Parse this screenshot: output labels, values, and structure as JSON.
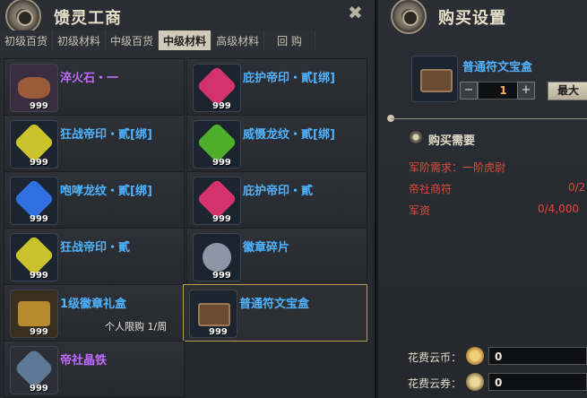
{
  "left_panel": {
    "title": "馈灵工商",
    "tabs": [
      {
        "label": "初级百货",
        "active": false
      },
      {
        "label": "初级材料",
        "active": false
      },
      {
        "label": "中级百货",
        "active": false
      },
      {
        "label": "中级材料",
        "active": true
      },
      {
        "label": "高级材料",
        "active": false
      },
      {
        "label": "回 购",
        "active": false
      }
    ],
    "items": [
      {
        "name": "淬火石・一",
        "count": "999",
        "icon": "ore-icon",
        "color": "#c06cff"
      },
      {
        "name": "庇护帝印・貳[绑]",
        "count": "999",
        "icon": "pink-gem-icon",
        "color": "#4fb4ff"
      },
      {
        "name": "狂战帝印・貳[绑]",
        "count": "999",
        "icon": "yellow-gem-icon",
        "color": "#4fb4ff"
      },
      {
        "name": "威慑龙纹・貳[绑]",
        "count": "999",
        "icon": "green-gem-icon",
        "color": "#4fb4ff"
      },
      {
        "name": "咆哮龙纹・貳[绑]",
        "count": "999",
        "icon": "blue-gem-icon",
        "color": "#4fb4ff"
      },
      {
        "name": "庇护帝印・貳",
        "count": "999",
        "icon": "pink-gem-icon",
        "color": "#4fb4ff"
      },
      {
        "name": "狂战帝印・貳",
        "count": "999",
        "icon": "yellow-gem-icon",
        "color": "#4fb4ff"
      },
      {
        "name": "徽章碎片",
        "count": "999",
        "icon": "badge-shard-icon",
        "color": "#4fb4ff"
      },
      {
        "name": "1级徽章礼盒",
        "count": "999",
        "icon": "gold-chest-icon",
        "color": "#4fb4ff",
        "limit": "个人限购 1/周"
      },
      {
        "name": "普通符文宝盒",
        "count": "999",
        "icon": "rune-chest-icon",
        "color": "#4fb4ff",
        "selected": true
      },
      {
        "name": "帝社晶铁",
        "count": "999",
        "icon": "crystal-iron-icon",
        "color": "#c06cff"
      }
    ]
  },
  "right_panel": {
    "title": "购买设置",
    "selected_item": "普通符文宝盒",
    "quantity": "1",
    "minus_label": "−",
    "plus_label": "+",
    "max_label": "最大",
    "requirements_title": "购买需要",
    "requirements": [
      {
        "label": "军阶需求：一阶虎尉",
        "value": ""
      },
      {
        "label": "帝社商符",
        "value": "0/2"
      },
      {
        "label": "军资",
        "value": "0/4,000"
      }
    ],
    "cost": [
      {
        "label": "花费云币：",
        "value": "0"
      },
      {
        "label": "花费云券：",
        "value": "0"
      }
    ]
  }
}
